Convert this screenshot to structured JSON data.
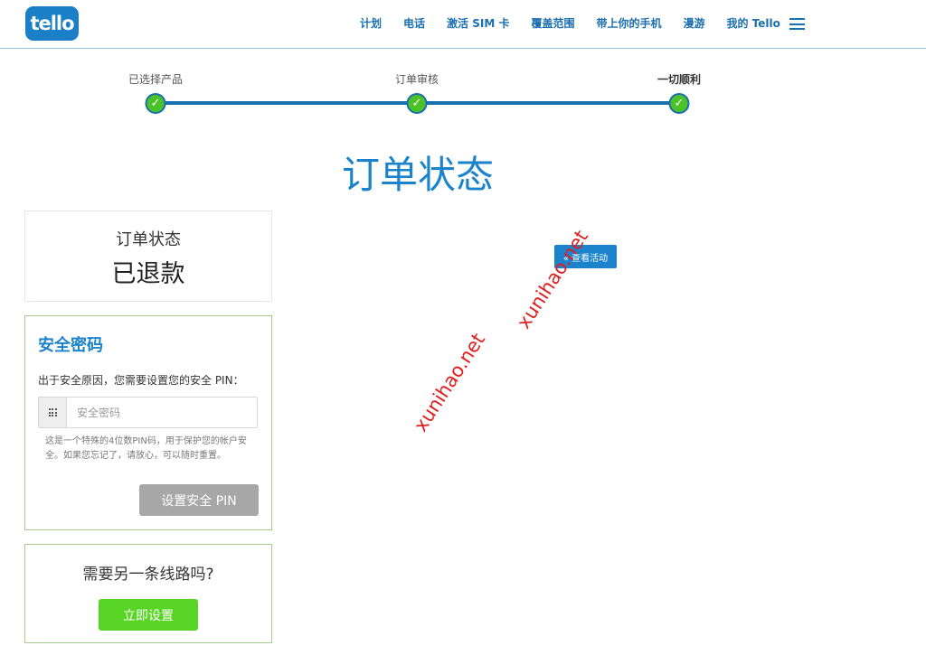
{
  "header": {
    "logo": "tello",
    "nav": [
      "计划",
      "电话",
      "激活 SIM 卡",
      "覆盖范围",
      "带上你的手机",
      "漫游",
      "我的 Tello"
    ],
    "menu_icon": "hamburger-menu-icon"
  },
  "progress": {
    "steps": [
      "已选择产品",
      "订单审核",
      "一切顺利"
    ],
    "completed": 3,
    "check_glyph": "✓"
  },
  "page_title": "订单状态",
  "status_card": {
    "label": "订单状态",
    "value": "已退款"
  },
  "pin_card": {
    "title": "安全密码",
    "description": "出于安全原因，您需要设置您的安全 PIN：",
    "input_placeholder": "安全密码",
    "input_icon": "keypad-grid-icon",
    "help": "这是一个特殊的4位数PIN码，用于保护您的帐户安全。如果您忘记了，请放心，可以随时重置。",
    "button": "设置安全 PIN"
  },
  "line_card": {
    "question": "需要另一条线路吗?",
    "button": "立即设置"
  },
  "back_button": "« 查看活动",
  "watermark": "xunihao.net",
  "colors": {
    "brand_blue": "#1a83cb",
    "success_green": "#58d524",
    "disabled_gray": "#a7a7a7",
    "watermark_red": "#e02020"
  }
}
